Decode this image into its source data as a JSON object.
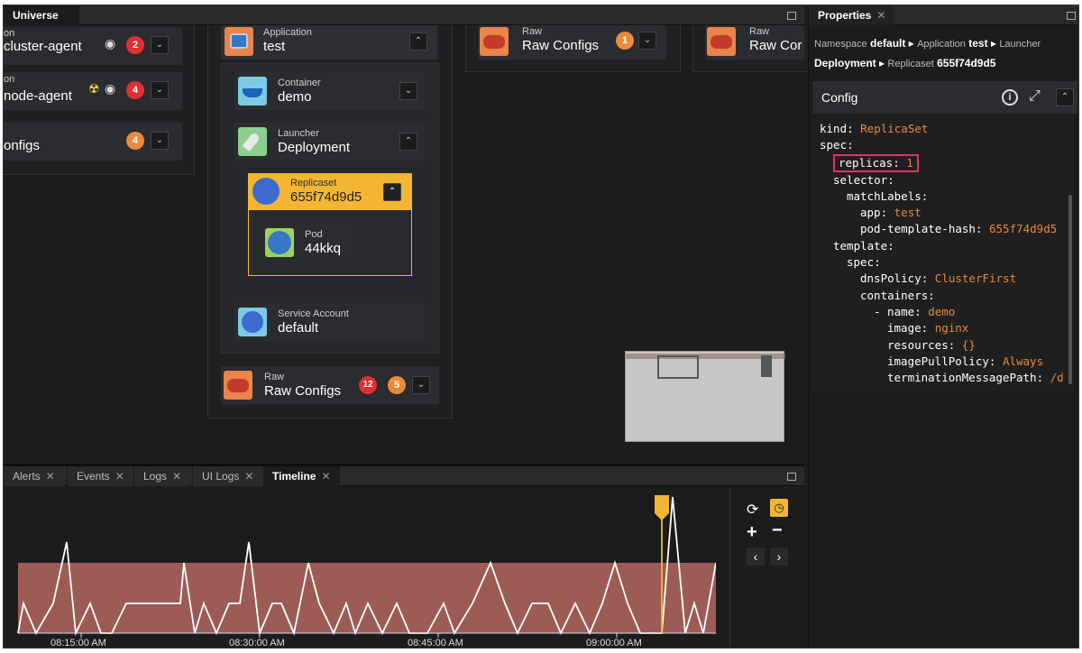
{
  "canvas": {
    "tab": "Universe",
    "left_cards": [
      {
        "kind": "on",
        "name": "cluster-agent",
        "badge": "2"
      },
      {
        "kind": "on",
        "name": "node-agent",
        "badge": "4"
      },
      {
        "kind": "",
        "name": "onfigs",
        "badge": "4"
      }
    ],
    "application": {
      "kind": "Application",
      "name": "test"
    },
    "container": {
      "kind": "Container",
      "name": "demo"
    },
    "launcher": {
      "kind": "Launcher",
      "name": "Deployment"
    },
    "replicaset": {
      "kind": "Replicaset",
      "name": "655f74d9d5"
    },
    "pod": {
      "kind": "Pod",
      "name": "44kkq"
    },
    "service_account": {
      "kind": "Service Account",
      "name": "default"
    },
    "raw_inner": {
      "kind": "Raw",
      "name": "Raw Configs",
      "badge_red": "12",
      "badge_orange": "5"
    },
    "raw_top1": {
      "kind": "Raw",
      "name": "Raw Configs",
      "badge": "1"
    },
    "raw_top2": {
      "kind": "Raw",
      "name": "Raw Cor"
    }
  },
  "properties": {
    "tab": "Properties",
    "bc": {
      "ns_label": "Namespace",
      "ns": "default",
      "app_label": "Application",
      "app": "test",
      "launcher_label": "Launcher",
      "deploy": "Deployment",
      "rs_label": "Replicaset",
      "rs": "655f74d9d5"
    },
    "config_title": "Config",
    "yaml": [
      {
        "k": "kind: ",
        "v": "ReplicaSet"
      },
      {
        "k": "spec:",
        "v": ""
      },
      {
        "k": "replicas: ",
        "v": "1"
      },
      {
        "k": "selector:",
        "v": ""
      },
      {
        "k": "matchLabels:",
        "v": ""
      },
      {
        "k": "app: ",
        "v": "test"
      },
      {
        "k": "pod-template-hash: ",
        "v": "655f74d9d5"
      },
      {
        "k": "template:",
        "v": ""
      },
      {
        "k": "spec:",
        "v": ""
      },
      {
        "k": "dnsPolicy: ",
        "v": "ClusterFirst"
      },
      {
        "k": "containers:",
        "v": ""
      },
      {
        "k": "- name: ",
        "v": "demo"
      },
      {
        "k": "image: ",
        "v": "nginx"
      },
      {
        "k": "resources: ",
        "v": "{}"
      },
      {
        "k": "imagePullPolicy: ",
        "v": "Always"
      },
      {
        "k": "terminationMessagePath: ",
        "v": "/d"
      }
    ]
  },
  "bottom": {
    "tabs": [
      "Alerts",
      "Events",
      "Logs",
      "UI Logs",
      "Timeline"
    ],
    "active": "Timeline",
    "times": [
      "08:15:00 AM",
      "08:30:00 AM",
      "08:45:00 AM",
      "09:00:00 AM"
    ]
  },
  "colors": {
    "accent": "#f2b632",
    "highlight": "#e0336b",
    "yaml_value": "#e8883a",
    "badge_red": "#e23030",
    "badge_orange": "#ea8a3c"
  }
}
